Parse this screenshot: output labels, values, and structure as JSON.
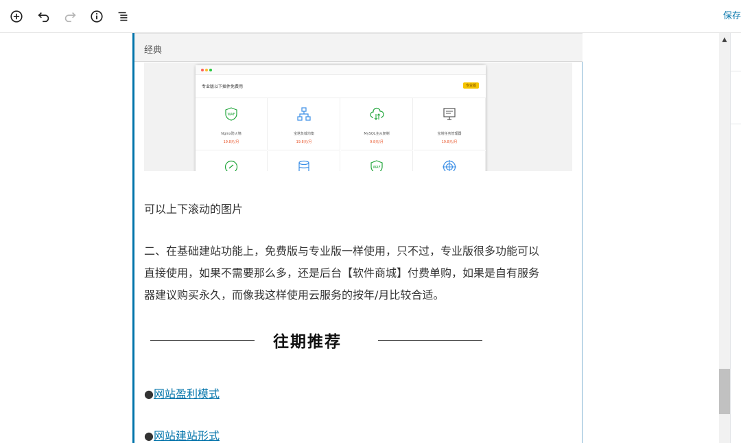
{
  "toolbar": {
    "icons": [
      "add-block-icon",
      "undo-icon",
      "redo-icon",
      "info-icon",
      "outline-icon"
    ],
    "save_label": "保存"
  },
  "block": {
    "header_label": "经典"
  },
  "preview": {
    "title": "专业版以下插件免费用",
    "badge": "专业版",
    "items": [
      {
        "name": "Nginx防火墙",
        "price": "19.8元/月",
        "icon": "waf-shield-icon",
        "color": "#20a53a"
      },
      {
        "name": "宝塔负载均衡",
        "price": "19.8元/月",
        "icon": "network-icon",
        "color": "#3a8ee6"
      },
      {
        "name": "MySQL主从复制",
        "price": "9.8元/月",
        "icon": "cloud-sync-icon",
        "color": "#20a53a"
      },
      {
        "name": "宝塔任务管理器",
        "price": "19.8元/月",
        "icon": "monitor-icon",
        "color": "#555555"
      },
      {
        "name": "",
        "price": "",
        "icon": "link-circle-icon",
        "color": "#20a53a"
      },
      {
        "name": "",
        "price": "",
        "icon": "database-icon",
        "color": "#3a8ee6"
      },
      {
        "name": "",
        "price": "",
        "icon": "waf-shield-icon",
        "color": "#20a53a"
      },
      {
        "name": "",
        "price": "",
        "icon": "target-icon",
        "color": "#3a8ee6"
      }
    ]
  },
  "content": {
    "caption": "可以上下滚动的图片",
    "para_line1": "二、在基础建站功能上，免费版与专业版一样使用，只不过，专业版很多功能可以",
    "para_line2": "直接使用，如果不需要那么多，还是后台【软件商城】付费单购，如果是自有服务",
    "para_line3": "器建议购买永久，而像我这样使用云服务的按年/月比较合适。",
    "section_heading": "往期推荐",
    "bullet": "●",
    "links": [
      "网站盈利模式",
      "网站建站形式"
    ]
  },
  "colors": {
    "accent": "#0073aa",
    "price": "#e8562b"
  }
}
